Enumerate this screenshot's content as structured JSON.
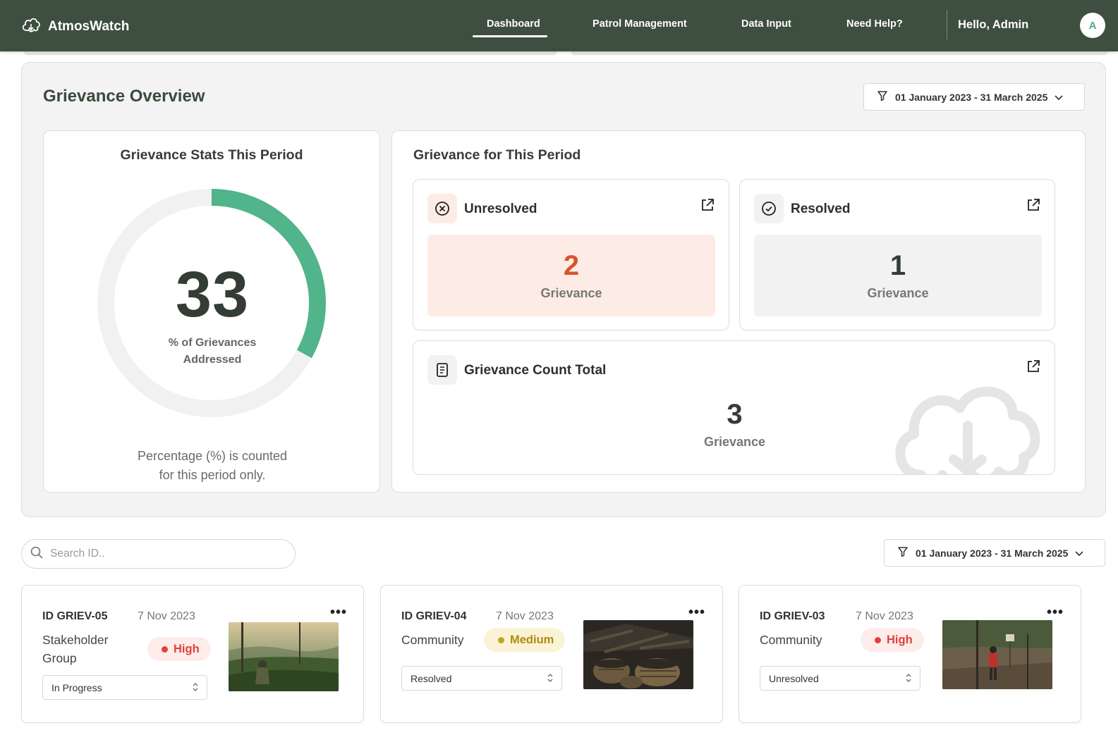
{
  "nav": {
    "brand": "AtmosWatch",
    "links": [
      "Dashboard",
      "Patrol Management",
      "Data Input",
      "Need Help?"
    ],
    "greeting": "Hello, Admin",
    "avatar_initial": "A"
  },
  "overview": {
    "title": "Grievance Overview",
    "date_range": "01 January 2023 - 31 March 2025",
    "stats": {
      "title": "Grievance Stats This Period",
      "percent": "33",
      "percent_value": 0.33,
      "label": "% of Grievances Addressed",
      "note_line1": "Percentage (%) is counted",
      "note_line2": "for this period only."
    },
    "period": {
      "title": "Grievance for This Period",
      "unresolved": {
        "label": "Unresolved",
        "count": "2",
        "unit": "Grievance"
      },
      "resolved": {
        "label": "Resolved",
        "count": "1",
        "unit": "Grievance"
      },
      "total": {
        "label": "Grievance Count Total",
        "count": "3",
        "unit": "Grievance"
      }
    }
  },
  "search": {
    "placeholder": "Search ID.."
  },
  "list_filter": {
    "date_range": "01 January 2023 - 31 March 2025"
  },
  "cards": [
    {
      "id": "ID GRIEV-05",
      "date": "7 Nov 2023",
      "category_line1": "Stakeholder",
      "category_line2": "Group",
      "priority": "High",
      "status": "In Progress"
    },
    {
      "id": "ID GRIEV-04",
      "date": "7 Nov 2023",
      "category_line1": "Community",
      "priority": "Medium",
      "status": "Resolved"
    },
    {
      "id": "ID GRIEV-03",
      "date": "7 Nov 2023",
      "category_line1": "Community",
      "priority": "High",
      "status": "Unresolved"
    }
  ],
  "colors": {
    "nav_bg": "#3e4e3f",
    "accent_green": "#52b48a",
    "unresolved_orange": "#d9542b",
    "unresolved_bg": "#fdece6",
    "high_red": "#e0413f",
    "medium_yellow": "#c9a21f"
  }
}
